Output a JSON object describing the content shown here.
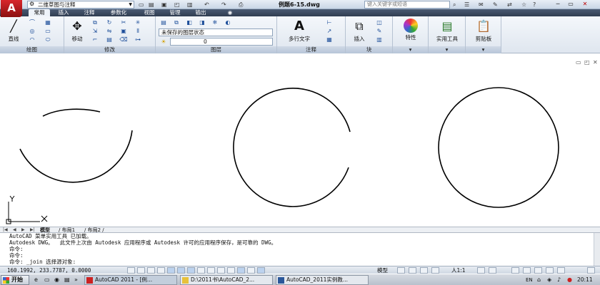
{
  "app": {
    "logo_text": "A",
    "workspace": "二维草图与注释",
    "document_title": "例题6-15.dwg",
    "search_placeholder": "键入关键字或短语"
  },
  "ribbon_tabs": [
    "常用",
    "插入",
    "注释",
    "参数化",
    "视图",
    "管理",
    "输出"
  ],
  "ribbon": {
    "line_label": "直线",
    "move_label": "移动",
    "layer_state": "未保存的图层状态",
    "layer_current": "0",
    "multiline_text_label": "多行文字",
    "insert_label": "插入",
    "properties_label": "特性",
    "utilities_label": "实用工具",
    "clipboard_label": "剪贴板",
    "panels": [
      "绘图",
      "修改",
      "图层",
      "注释",
      "块"
    ]
  },
  "layout_tabs": [
    "模型",
    "布局1",
    "布局2"
  ],
  "command_lines": [
    "AutoCAD 菜单实用工具 已加载。",
    "Autodesk DWG。  此文件上次由 Autodesk 应用程序或 Autodesk 许可的应用程序保存，是可靠的 DWG。",
    "命令:",
    "命令:",
    "命令: _join 选择源对象:"
  ],
  "status": {
    "coords": "160.1992, 233.7787, 0.0000",
    "model_label": "模型",
    "scale_label": "人1:1",
    "clock": "20:11"
  },
  "taskbar": {
    "start_label": "开始",
    "tasks": [
      "AutoCAD 2011 - [例...",
      "D:\\2011书\\AutoCAD_2...",
      "AutoCAD_2011实例教..."
    ]
  },
  "colors": {
    "ribbon_tab_bg": "#3b4a60",
    "drawing_bg": "#ffffff",
    "geometry": "#000000"
  }
}
